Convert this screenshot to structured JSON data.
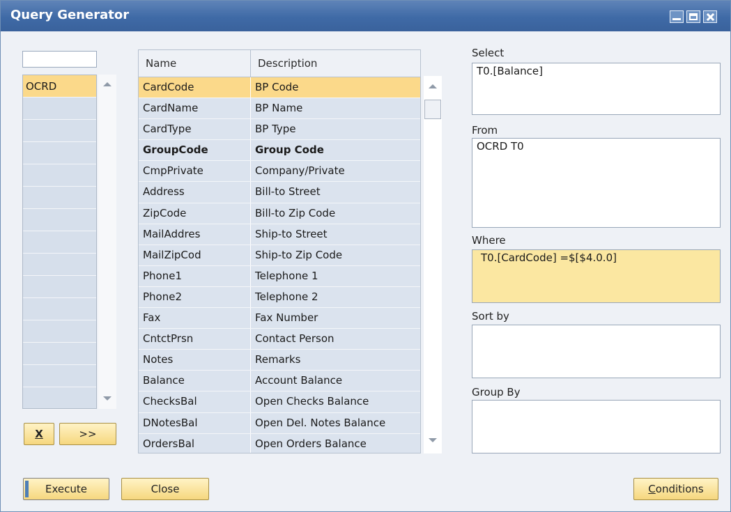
{
  "window": {
    "title": "Query Generator"
  },
  "tables": {
    "items": [
      "OCRD",
      "",
      "",
      "",
      "",
      "",
      "",
      "",
      "",
      "",
      "",
      "",
      "",
      "",
      ""
    ]
  },
  "fields": {
    "headers": [
      "Name",
      "Description"
    ],
    "rows": [
      {
        "name": "CardCode",
        "desc": "BP Code"
      },
      {
        "name": "CardName",
        "desc": "BP Name"
      },
      {
        "name": "CardType",
        "desc": "BP Type"
      },
      {
        "name": "GroupCode",
        "desc": "Group Code"
      },
      {
        "name": "CmpPrivate",
        "desc": "Company/Private"
      },
      {
        "name": "Address",
        "desc": "Bill-to Street"
      },
      {
        "name": "ZipCode",
        "desc": "Bill-to Zip Code"
      },
      {
        "name": "MailAddres",
        "desc": "Ship-to Street"
      },
      {
        "name": "MailZipCod",
        "desc": "Ship-to Zip Code"
      },
      {
        "name": "Phone1",
        "desc": "Telephone 1"
      },
      {
        "name": "Phone2",
        "desc": "Telephone 2"
      },
      {
        "name": "Fax",
        "desc": "Fax Number"
      },
      {
        "name": "CntctPrsn",
        "desc": "Contact Person"
      },
      {
        "name": "Notes",
        "desc": "Remarks"
      },
      {
        "name": "Balance",
        "desc": "Account Balance"
      },
      {
        "name": "ChecksBal",
        "desc": "Open Checks Balance"
      },
      {
        "name": "DNotesBal",
        "desc": "Open Del. Notes Balance"
      },
      {
        "name": "OrdersBal",
        "desc": "Open Orders Balance"
      }
    ]
  },
  "query": {
    "select_label": "Select",
    "select_value": "T0.[Balance]",
    "from_label": "From",
    "from_value": "OCRD T0",
    "where_label": "Where",
    "where_value": "T0.[CardCode] =$[$4.0.0]",
    "sort_label": "Sort by",
    "sort_value": "",
    "group_label": "Group By",
    "group_value": ""
  },
  "buttons": {
    "remove": "X",
    "move": ">>",
    "execute": "Execute",
    "close": "Close",
    "conditions_first": "C",
    "conditions_rest": "onditions"
  },
  "colors": {
    "selected": "#fbd98a",
    "titlebar": "#3f6aa6",
    "where_bg": "#fbe7a1"
  }
}
